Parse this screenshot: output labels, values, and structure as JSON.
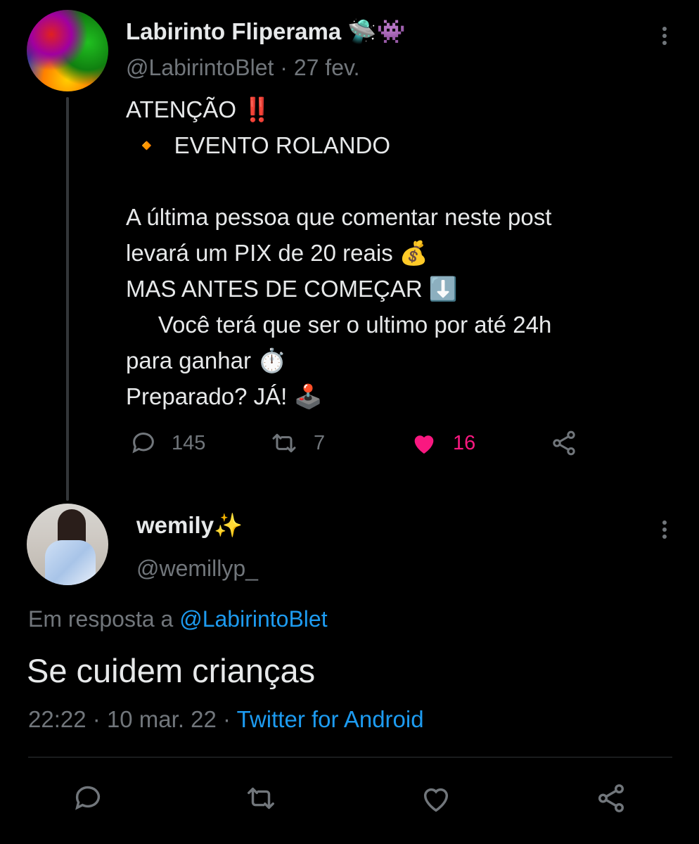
{
  "original_tweet": {
    "display_name": "Labirinto Fliperama",
    "name_emojis": "🛸👾",
    "handle": "@LabirintoBlet",
    "date_separator": "·",
    "date": "27 fev.",
    "body_lines": [
      "ATENÇÃO ‼️",
      " 🔸  EVENTO ROLANDO",
      "",
      "A última pessoa que comentar neste post",
      "levará um PIX de 20 reais 💰",
      "MAS ANTES DE COMEÇAR ⬇️",
      "     Você terá que ser o ultimo por até 24h",
      "para ganhar ⏱️",
      "Preparado? JÁ! 🕹️"
    ],
    "actions": {
      "reply_count": "145",
      "retweet_count": "7",
      "like_count": "16"
    },
    "liked": true
  },
  "reply_tweet": {
    "display_name": "wemily✨",
    "handle": "@wemillyp_",
    "replying_prefix": "Em resposta a ",
    "replying_to": "@LabirintoBlet",
    "text": "Se cuidem crianças",
    "time": "22:22",
    "date": "10 mar. 22",
    "separator": "·",
    "source": "Twitter for Android"
  },
  "colors": {
    "background": "#000000",
    "text_primary": "#e7e9ea",
    "text_secondary": "#71767b",
    "link": "#1d9bf0",
    "like": "#f91880"
  },
  "icons": [
    "reply-icon",
    "retweet-icon",
    "like-icon",
    "share-icon",
    "more-options-icon"
  ]
}
